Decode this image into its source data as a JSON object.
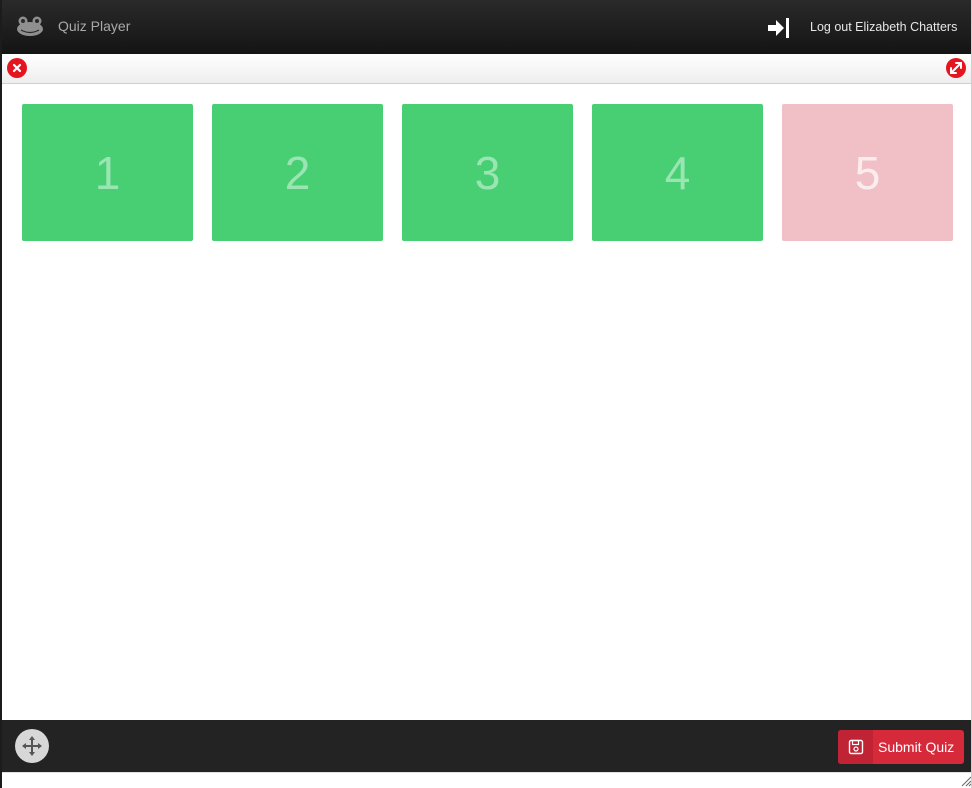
{
  "app": {
    "title": "Quiz Player",
    "logo_icon": "frog-logo-icon"
  },
  "header": {
    "logout_label": "Log out Elizabeth Chatters",
    "logout_icon": "sign-out-icon"
  },
  "toolbar": {
    "close_icon": "close-icon",
    "expand_icon": "expand-icon",
    "accent_color": "#e4151f"
  },
  "questions": [
    {
      "label": "1",
      "status": "answered"
    },
    {
      "label": "2",
      "status": "answered"
    },
    {
      "label": "3",
      "status": "answered"
    },
    {
      "label": "4",
      "status": "answered"
    },
    {
      "label": "5",
      "status": "unanswered"
    }
  ],
  "colors": {
    "answered": "#48cf74",
    "unanswered": "#f1c0c6",
    "submit": "#d6293a"
  },
  "footer": {
    "move_icon": "move-icon",
    "submit_label": "Submit Quiz",
    "submit_icon": "save-icon"
  }
}
